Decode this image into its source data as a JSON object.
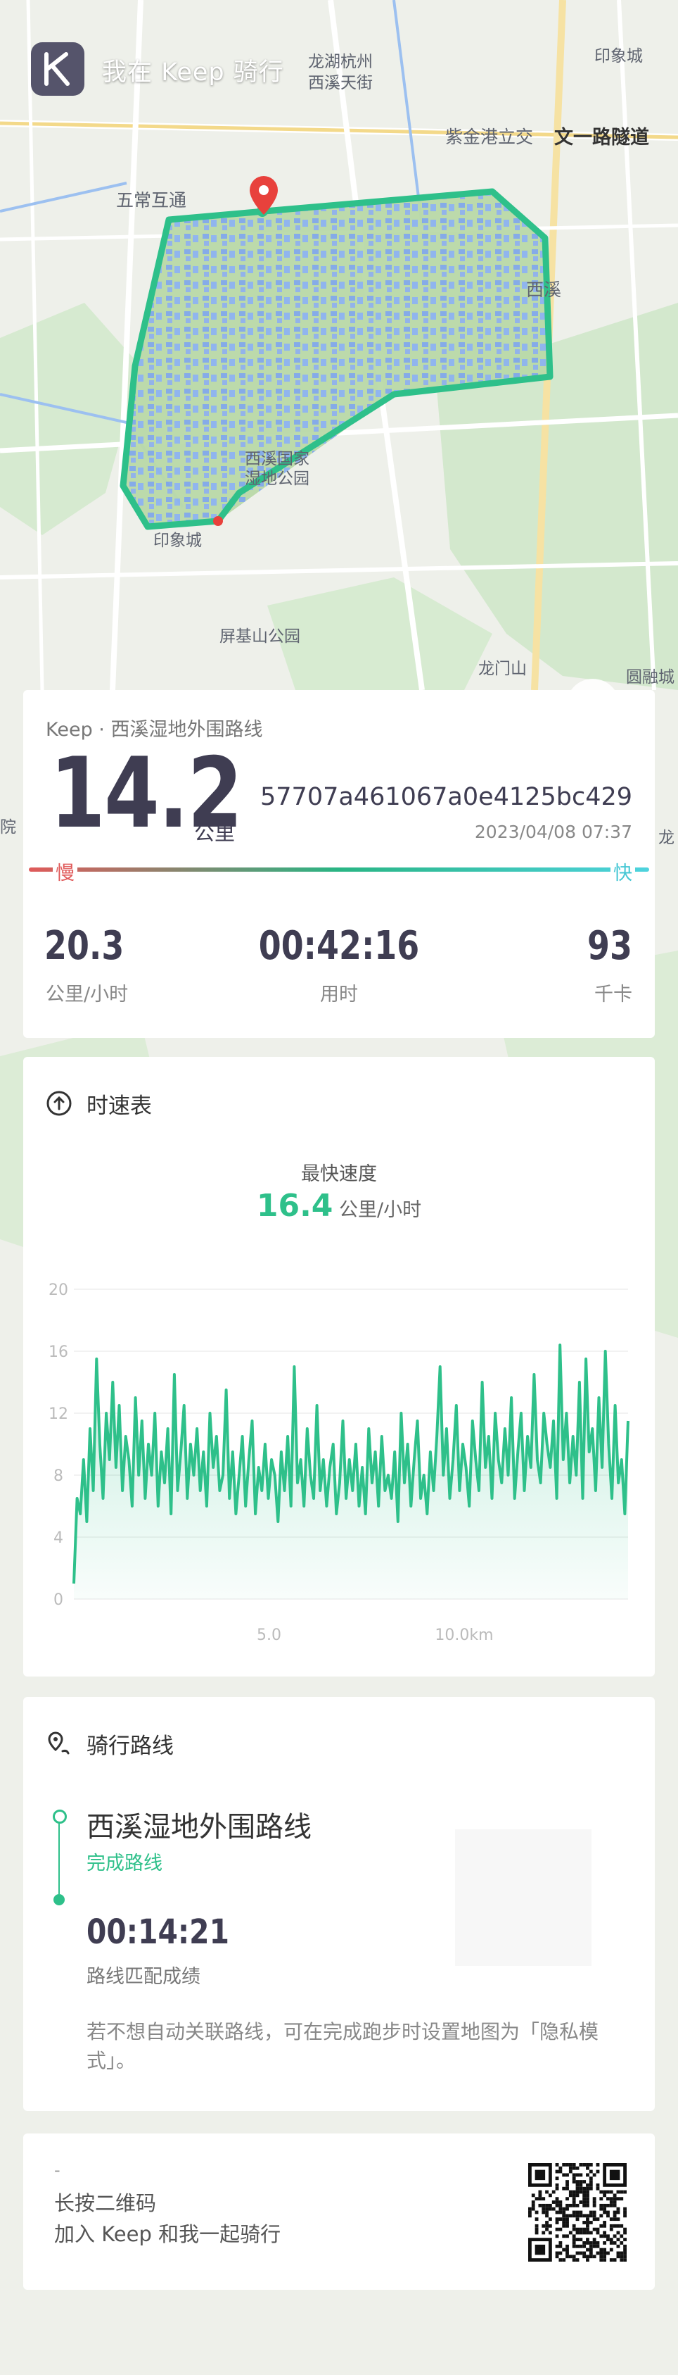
{
  "header": {
    "title": "我在 Keep 骑行"
  },
  "map": {
    "labels": {
      "lh": "龙湖杭州",
      "xxtj": "西溪天街",
      "yxc_top": "印象城",
      "zjg": "紫金港立交",
      "wylsd": "文一路隧道",
      "wchq": "五常互通",
      "xx": "西溪",
      "xxgj1": "西溪国家",
      "xxgj2": "湿地公园",
      "yxc": "印象城",
      "pjs": "屏基山公园",
      "lms": "龙门山",
      "ylc": "圆融城",
      "yuan": "院",
      "long": "龙"
    }
  },
  "summary": {
    "source": "Keep · 西溪湿地外围路线",
    "distance": "14.2",
    "distance_unit": "公里",
    "record_id": "57707a461067a0e4125bc429",
    "datetime": "2023/04/08 07:37",
    "slow_label": "慢",
    "fast_label": "快",
    "stats": [
      {
        "value": "20.3",
        "label": "公里/小时"
      },
      {
        "value": "00:42:16",
        "label": "用时"
      },
      {
        "value": "93",
        "label": "千卡"
      }
    ]
  },
  "speed_card": {
    "title": "时速表",
    "fastest_label": "最快速度",
    "fastest_value": "16.4",
    "fastest_unit": "公里/小时"
  },
  "chart_data": {
    "type": "area",
    "title": "时速表",
    "xlabel": "",
    "ylabel": "",
    "ylim": [
      0,
      20
    ],
    "xlim": [
      0,
      14.2
    ],
    "yticks": [
      0,
      4,
      8,
      12,
      16,
      20
    ],
    "xticks": [
      5.0,
      10.0
    ],
    "xtick_labels": [
      "5.0",
      "10.0km"
    ],
    "grid": true,
    "color": "#2ec08a",
    "series": [
      {
        "values": [
          1.0,
          6.5,
          5.5,
          9.0,
          5.0,
          11.0,
          7.0,
          15.5,
          10.0,
          6.5,
          12.0,
          9.0,
          14.0,
          8.5,
          12.5,
          7.0,
          10.5,
          9.0,
          6.0,
          13.0,
          8.0,
          11.5,
          6.5,
          10.0,
          8.0,
          12.0,
          6.0,
          9.5,
          7.5,
          11.0,
          5.5,
          14.5,
          7.0,
          9.5,
          12.5,
          6.5,
          10.0,
          8.0,
          11.0,
          7.0,
          9.5,
          6.0,
          12.0,
          8.5,
          10.5,
          7.0,
          8.0,
          13.5,
          6.5,
          9.5,
          5.5,
          8.0,
          10.5,
          6.0,
          9.0,
          11.5,
          5.5,
          8.5,
          7.0,
          10.0,
          6.5,
          9.0,
          8.0,
          5.0,
          9.5,
          7.0,
          10.5,
          6.0,
          15.0,
          7.5,
          9.0,
          6.0,
          11.0,
          8.0,
          6.5,
          12.5,
          7.0,
          9.0,
          6.0,
          8.5,
          10.0,
          5.5,
          7.5,
          11.5,
          6.5,
          9.0,
          7.0,
          10.0,
          6.0,
          8.5,
          5.5,
          11.0,
          7.5,
          9.5,
          6.0,
          10.5,
          7.0,
          8.0,
          6.5,
          9.5,
          5.0,
          12.0,
          7.5,
          10.0,
          6.0,
          9.0,
          11.5,
          6.5,
          8.0,
          5.5,
          9.5,
          7.0,
          10.5,
          15.0,
          8.0,
          11.0,
          6.5,
          9.0,
          12.5,
          7.0,
          10.0,
          8.5,
          6.0,
          11.5,
          9.0,
          7.0,
          14.0,
          8.5,
          10.5,
          6.5,
          12.0,
          9.0,
          7.5,
          11.0,
          8.0,
          13.0,
          6.5,
          9.5,
          12.0,
          7.0,
          10.5,
          8.5,
          14.5,
          9.0,
          7.5,
          12.0,
          10.0,
          8.5,
          11.5,
          6.5,
          16.4,
          9.0,
          12.0,
          7.5,
          10.5,
          8.0,
          14.0,
          6.5,
          15.5,
          9.5,
          11.0,
          7.0,
          13.0,
          8.5,
          16.0,
          10.0,
          6.5,
          12.5,
          7.5,
          9.0,
          5.5,
          11.5
        ]
      }
    ]
  },
  "route_card": {
    "title": "骑行路线",
    "route_name": "西溪湿地外围路线",
    "status": "完成路线",
    "time": "00:14:21",
    "time_label": "路线匹配成绩",
    "note": "若不想自动关联路线，可在完成跑步时设置地图为「隐私模式」。"
  },
  "qr_card": {
    "dash": "-",
    "line1": "长按二维码",
    "line2": "加入 Keep 和我一起骑行"
  },
  "colors": {
    "accent": "#2ec08a",
    "slow": "#e05a5a",
    "fast": "#45c7d4",
    "logo_bg": "#55546b"
  }
}
